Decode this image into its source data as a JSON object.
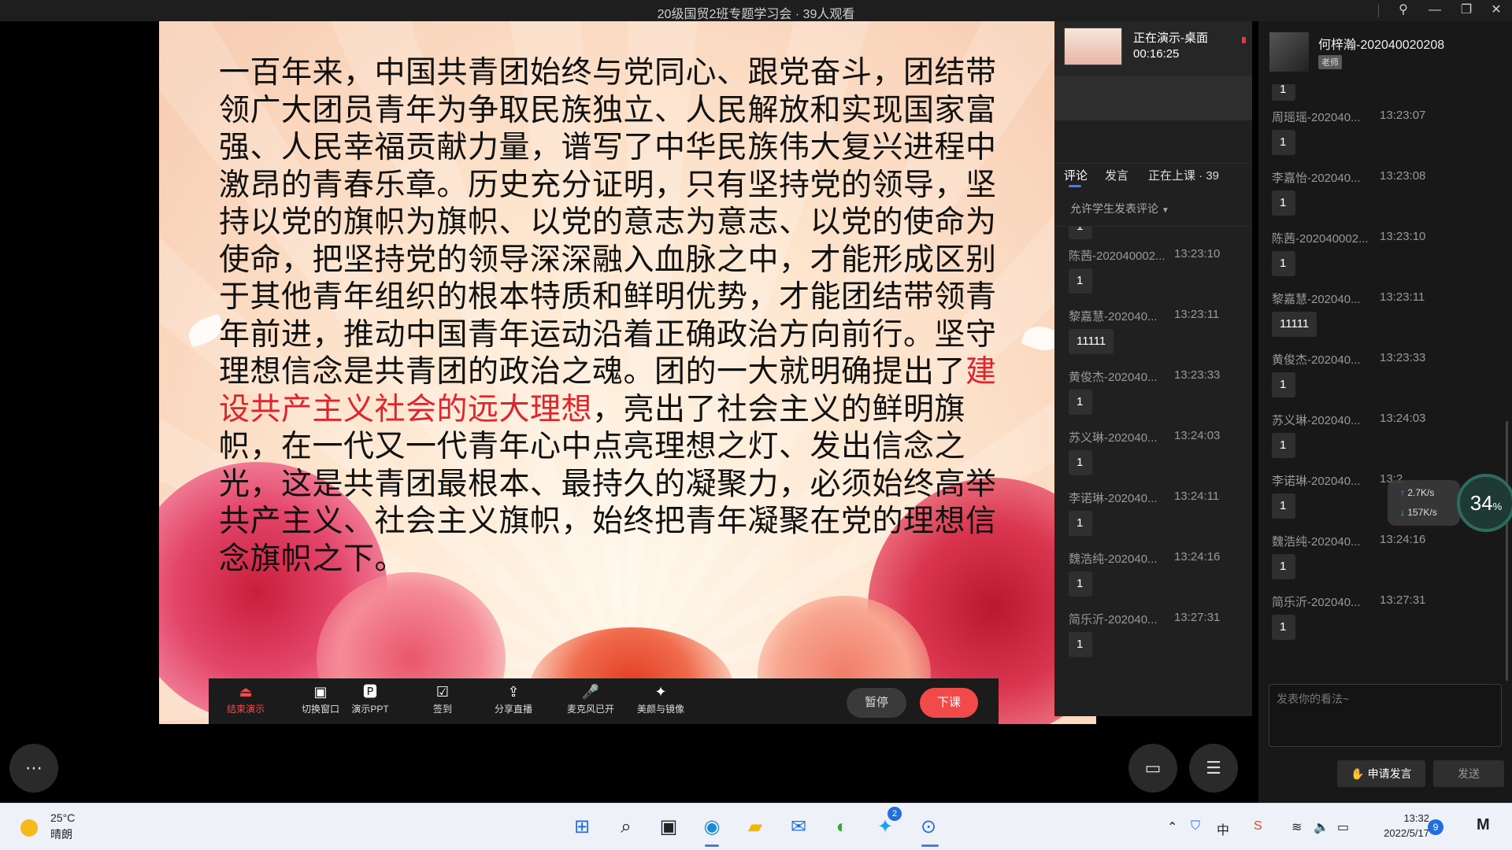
{
  "titlebar": {
    "title": "20级国贸2班专题学习会 · 39人观看",
    "icons": [
      "pin-icon",
      "minimize-icon",
      "restore-icon",
      "close-icon"
    ]
  },
  "slide": {
    "text_before": "一百年来，中国共青团始终与党同心、跟党奋斗，团结带领广大团员青年为争取民族独立、人民解放和实现国家富强、人民幸福贡献力量，谱写了中华民族伟大复兴进程中激昂的青春乐章。历史充分证明，只有坚持党的领导，坚持以党的旗帜为旗帜、以党的意志为意志、以党的使命为使命，把坚持党的领导深深融入血脉之中，才能形成区别于其他青年组织的根本特质和鲜明优势，才能团结带领青年前进，推动中国青年运动沿着正确政治方向前行。坚守理想信念是共青团的政治之魂。团的一大就明确提出了",
    "text_highlight": "建设共产主义社会的远大理想",
    "text_after": "，亮出了社会主义的鲜明旗帜，在一代又一代青年心中点亮理想之灯、发出信念之光，这是共青团最根本、最持久的凝聚力，必须始终高举共产主义、社会主义旗帜，始终把青年凝聚在党的理想信念旗帜之下。",
    "highlight_color": "#e0242d"
  },
  "presenter_toolbar": {
    "buttons": [
      {
        "label": "结束演示",
        "icon": "stop-presenting-icon"
      },
      {
        "label": "切换窗口",
        "icon": "switch-window-icon"
      },
      {
        "label": "演示PPT",
        "icon": "ppt-icon"
      },
      {
        "label": "签到",
        "icon": "checkin-icon"
      },
      {
        "label": "分享直播",
        "icon": "share-icon"
      },
      {
        "label": "麦克风已开",
        "icon": "microphone-icon"
      },
      {
        "label": "美颜与镜像",
        "icon": "beauty-icon"
      }
    ],
    "pause_label": "暂停",
    "end_class_label": "下课"
  },
  "presenting": {
    "status": "正在演示-桌面",
    "duration": "00:16:25"
  },
  "mid_panel": {
    "tabs": [
      "评论",
      "发言",
      "正在上课 · 39"
    ],
    "permission": "允许学生发表评论",
    "messages": [
      {
        "name": "陈茜-202040002...",
        "time": "13:23:10",
        "text": "1"
      },
      {
        "name": "黎嘉慧-202040...",
        "time": "13:23:11",
        "text": "11111"
      },
      {
        "name": "黄俊杰-202040...",
        "time": "13:23:33",
        "text": "1"
      },
      {
        "name": "苏义琳-202040...",
        "time": "13:24:03",
        "text": "1"
      },
      {
        "name": "李诺琳-202040...",
        "time": "13:24:11",
        "text": "1"
      },
      {
        "name": "魏浩纯-202040...",
        "time": "13:24:16",
        "text": "1"
      },
      {
        "name": "简乐沂-202040...",
        "time": "13:27:31",
        "text": "1"
      }
    ]
  },
  "right_panel": {
    "teacher_name": "何梓瀚-202040020208",
    "teacher_badge": "老师",
    "messages": [
      {
        "name": "周瑶瑶-202040...",
        "time": "13:23:07",
        "text": "1"
      },
      {
        "name": "李嘉怡-202040...",
        "time": "13:23:08",
        "text": "1"
      },
      {
        "name": "陈茜-202040002...",
        "time": "13:23:10",
        "text": "1"
      },
      {
        "name": "黎嘉慧-202040...",
        "time": "13:23:11",
        "text": "11111"
      },
      {
        "name": "黄俊杰-202040...",
        "time": "13:23:33",
        "text": "1"
      },
      {
        "name": "苏义琳-202040...",
        "time": "13:24:03",
        "text": "1"
      },
      {
        "name": "李诺琳-202040...",
        "time": "13:2",
        "text": "1"
      },
      {
        "name": "魏浩纯-202040...",
        "time": "13:24:16",
        "text": "1"
      },
      {
        "name": "简乐沂-202040...",
        "time": "13:27:31",
        "text": "1"
      }
    ],
    "input_placeholder": "发表你的看法~",
    "raise_hand_label": "申请发言",
    "send_label": "发送"
  },
  "network": {
    "upload": "2.7K/s",
    "download": "157K/s",
    "percent": "34",
    "percent_unit": "%"
  },
  "taskbar": {
    "temperature": "25°C",
    "condition": "晴朗",
    "time": "13:32",
    "date": "2022/5/17",
    "notification_count": "9",
    "twitter_badge": "2",
    "ime": "中",
    "apps": [
      "windows-start-icon",
      "search-icon",
      "task-view-icon",
      "edge-icon",
      "file-explorer-icon",
      "mail-icon",
      "browser-icon",
      "twitter-icon",
      "classroom-app-icon"
    ]
  }
}
